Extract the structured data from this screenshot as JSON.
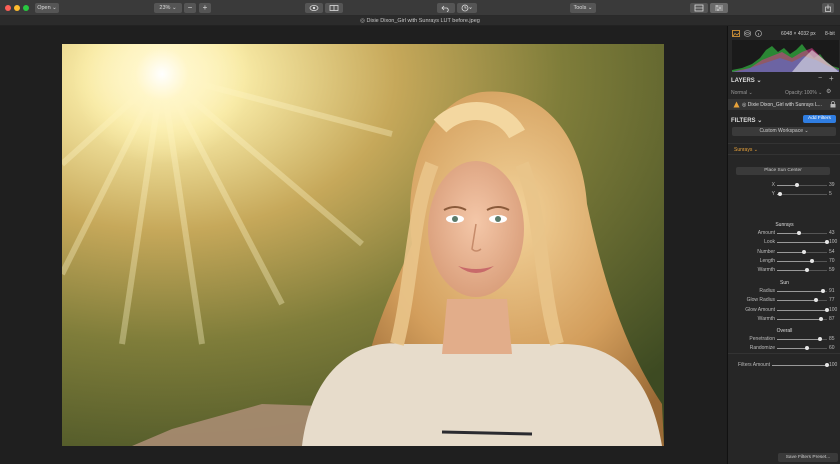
{
  "toolbar": {
    "open_label": "Open ⌄",
    "zoom_label": "23% ⌄",
    "tools_label": "Tools ⌄"
  },
  "file": {
    "title": "◎ Dixie Dixon_Girl with Sunrays LUT before.jpeg"
  },
  "histogram": {
    "dimensions": "6048 × 4032 px",
    "bit_depth": "8-bit"
  },
  "layers": {
    "header": "LAYERS ⌄",
    "blend_mode": "Normal ⌄",
    "opacity_label": "Opacity:",
    "opacity_value": "100% ⌄",
    "layer_name": "◎ Dixie Dixon_Girl with Sunrays L..."
  },
  "filters": {
    "header": "FILTERS ⌄",
    "add_button": "Add Filters",
    "workspace": "Custom Workspace ⌄",
    "filter_name": "Sunrays ⌄",
    "place_sun_center": "Place Sun Center",
    "groups": [
      {
        "title": "",
        "sliders": [
          {
            "label": "X",
            "value": "39",
            "fraction": 0.39
          },
          {
            "label": "Y",
            "value": "5",
            "fraction": 0.05
          }
        ]
      },
      {
        "title": "Sunrays",
        "sliders": [
          {
            "label": "Amount",
            "value": "43",
            "fraction": 0.43
          },
          {
            "label": "Look",
            "value": "100",
            "fraction": 1.0
          },
          {
            "label": "Number",
            "value": "54",
            "fraction": 0.54
          },
          {
            "label": "Length",
            "value": "70",
            "fraction": 0.7
          },
          {
            "label": "Warmth",
            "value": "59",
            "fraction": 0.59
          }
        ]
      },
      {
        "title": "Sun",
        "sliders": [
          {
            "label": "Radius",
            "value": "91",
            "fraction": 0.91
          },
          {
            "label": "Glow Radius",
            "value": "77",
            "fraction": 0.77
          },
          {
            "label": "Glow Amount",
            "value": "100",
            "fraction": 1.0
          },
          {
            "label": "Warmth",
            "value": "87",
            "fraction": 0.87
          }
        ]
      },
      {
        "title": "Overall",
        "sliders": [
          {
            "label": "Penetration",
            "value": "85",
            "fraction": 0.85
          },
          {
            "label": "Randomize",
            "value": "60",
            "fraction": 0.6
          }
        ]
      }
    ],
    "filters_amount": {
      "label": "Filters Amount",
      "value": "100",
      "fraction": 1.0
    }
  },
  "footer": {
    "save_preset": "Save Filters Preset..."
  },
  "colors": {
    "accent_blue": "#2f7de1",
    "accent_orange": "#e8a23a",
    "panel": "#262626"
  }
}
